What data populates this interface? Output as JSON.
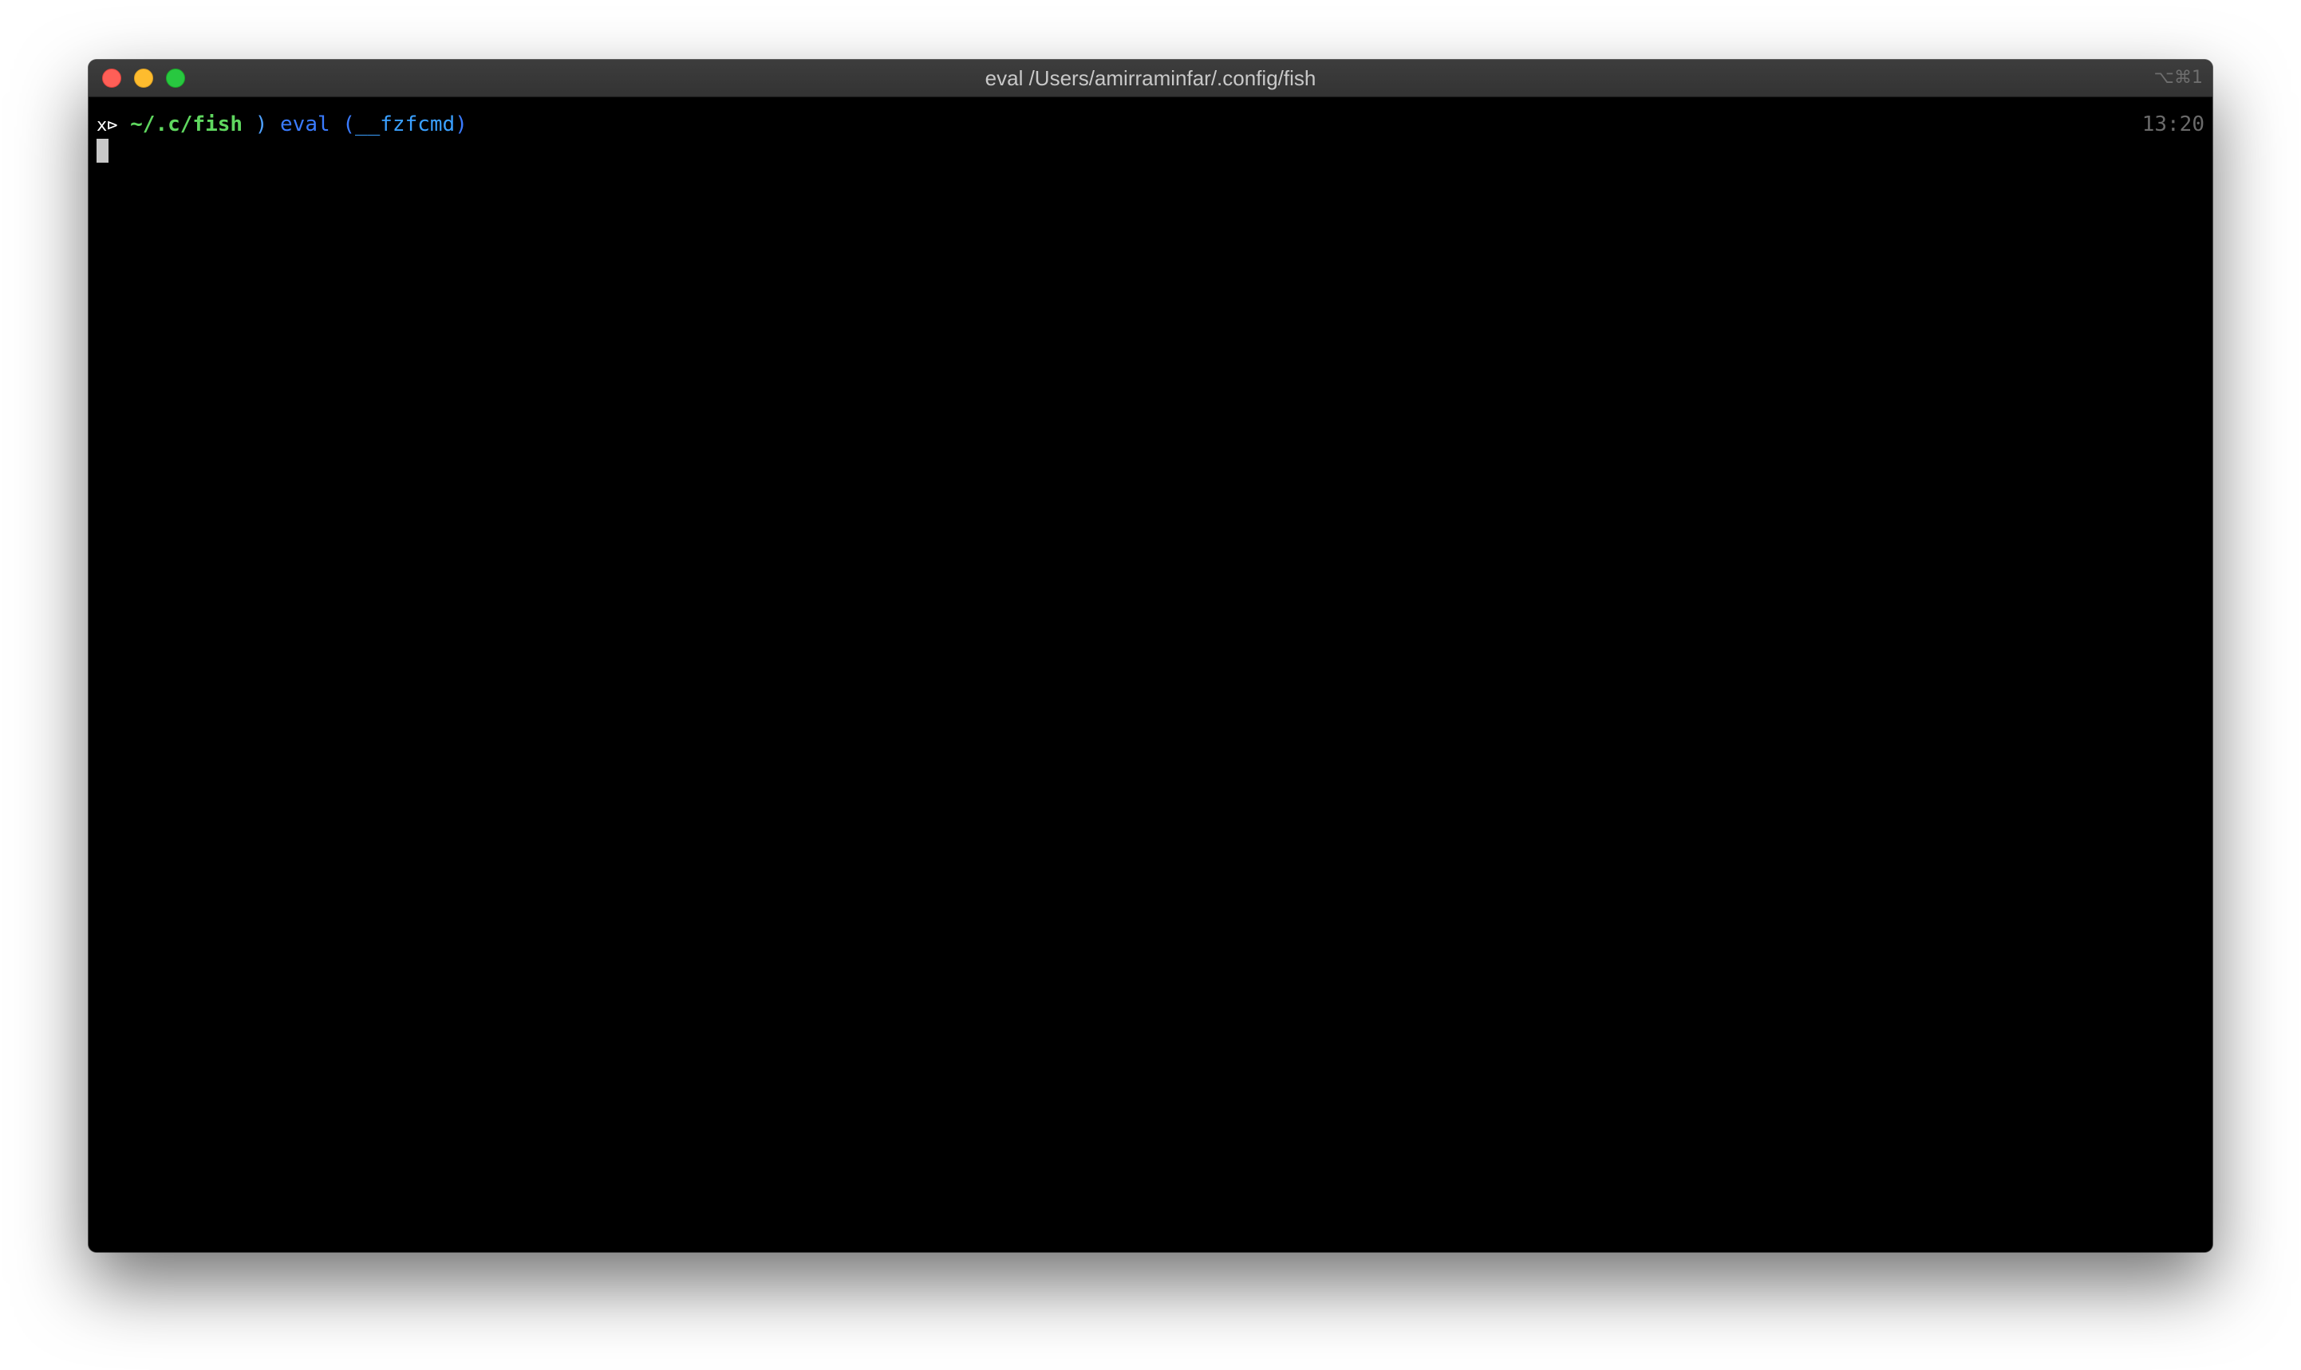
{
  "window": {
    "title": "eval /Users/amirraminfar/.config/fish",
    "shortcut": "⌥⌘1"
  },
  "controls": {
    "close_icon": "close-icon",
    "minimize_icon": "minimize-icon",
    "zoom_icon": "zoom-icon"
  },
  "terminal": {
    "prompt_symbol": "x⊳",
    "cwd": "~/.c/fish",
    "separator": ")",
    "command": "eval",
    "open_paren": "(",
    "argument": "__fzfcmd",
    "close_paren": ")",
    "right_prompt_time": "13:20"
  },
  "colors": {
    "background": "#000000",
    "cwd": "#5fd75f",
    "command": "#3a7bff",
    "titlebar": "#3a3a3a"
  }
}
